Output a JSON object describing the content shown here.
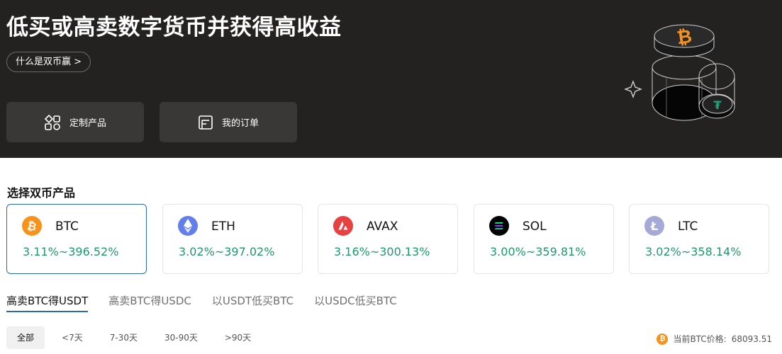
{
  "hero": {
    "title": "低买或高卖数字货币并获得高收益",
    "link_label": "什么是双币赢 >",
    "cards": [
      {
        "label": "定制产品",
        "icon": "grid-blocks-icon"
      },
      {
        "label": "我的订单",
        "icon": "order-list-icon"
      }
    ]
  },
  "section": {
    "title": "选择双币产品"
  },
  "coins": [
    {
      "symbol": "BTC",
      "rate": "3.11%~396.52%",
      "icon": "btc-icon",
      "color": "#f7931a",
      "selected": true
    },
    {
      "symbol": "ETH",
      "rate": "3.02%~397.02%",
      "icon": "eth-icon",
      "color": "#627eea",
      "selected": false
    },
    {
      "symbol": "AVAX",
      "rate": "3.16%~300.13%",
      "icon": "avax-icon",
      "color": "#e84142",
      "selected": false
    },
    {
      "symbol": "SOL",
      "rate": "3.00%~359.81%",
      "icon": "sol-icon",
      "color": "#000000",
      "selected": false
    },
    {
      "symbol": "LTC",
      "rate": "3.02%~358.14%",
      "icon": "ltc-icon",
      "color": "#a5a9d6",
      "selected": false
    }
  ],
  "tabs": [
    {
      "label": "高卖BTC得USDT",
      "active": true
    },
    {
      "label": "高卖BTC得USDC",
      "active": false
    },
    {
      "label": "以USDT低买BTC",
      "active": false
    },
    {
      "label": "以USDC低买BTC",
      "active": false
    }
  ],
  "filters": [
    {
      "label": "全部",
      "active": true
    },
    {
      "label": "<7天",
      "active": false
    },
    {
      "label": "7-30天",
      "active": false
    },
    {
      "label": "30-90天",
      "active": false
    },
    {
      "label": ">90天",
      "active": false
    }
  ],
  "price": {
    "label": "当前BTC价格:",
    "value": "68093.51"
  },
  "colors": {
    "accent": "#2d6aa8",
    "positive": "#1d9a6c",
    "hero_bg": "#232221"
  }
}
